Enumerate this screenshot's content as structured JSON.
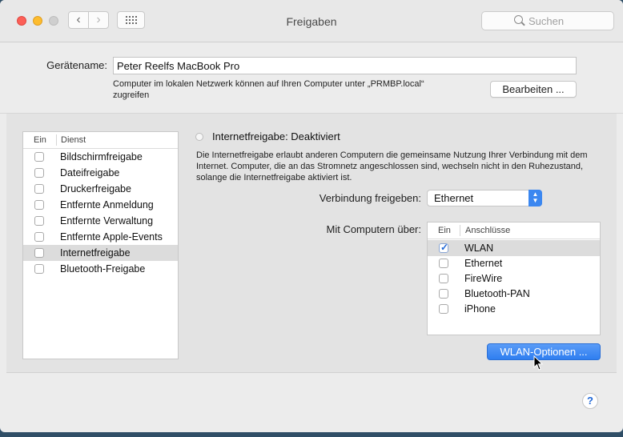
{
  "window": {
    "title": "Freigaben",
    "search_placeholder": "Suchen"
  },
  "device": {
    "label": "Gerätename:",
    "value": "Peter Reelfs MacBook Pro",
    "hint_line1": "Computer im lokalen Netzwerk können auf Ihren Computer unter „PRMBP.local“",
    "hint_line2": "zugreifen",
    "edit_button": "Bearbeiten ..."
  },
  "services": {
    "col_on": "Ein",
    "col_service": "Dienst",
    "items": [
      {
        "label": "Bildschirmfreigabe",
        "checked": false,
        "selected": false
      },
      {
        "label": "Dateifreigabe",
        "checked": false,
        "selected": false
      },
      {
        "label": "Druckerfreigabe",
        "checked": false,
        "selected": false
      },
      {
        "label": "Entfernte Anmeldung",
        "checked": false,
        "selected": false
      },
      {
        "label": "Entfernte Verwaltung",
        "checked": false,
        "selected": false
      },
      {
        "label": "Entfernte Apple-Events",
        "checked": false,
        "selected": false
      },
      {
        "label": "Internetfreigabe",
        "checked": false,
        "selected": true
      },
      {
        "label": "Bluetooth-Freigabe",
        "checked": false,
        "selected": false
      }
    ]
  },
  "detail": {
    "status": "Internetfreigabe: Deaktiviert",
    "description": "Die Internetfreigabe erlaubt anderen Computern die gemeinsame Nutzung Ihrer Verbindung mit dem Internet. Computer, die an das Stromnetz angeschlossen sind, wechseln nicht in den Ruhezustand, solange die Internetfreigabe aktiviert ist.",
    "share_label": "Verbindung freigeben:",
    "share_value": "Ethernet",
    "to_label": "Mit Computern über:",
    "ports_col_on": "Ein",
    "ports_col_name": "Anschlüsse",
    "ports": [
      {
        "label": "WLAN",
        "checked": true,
        "selected": true
      },
      {
        "label": "Ethernet",
        "checked": false,
        "selected": false
      },
      {
        "label": "FireWire",
        "checked": false,
        "selected": false
      },
      {
        "label": "Bluetooth-PAN",
        "checked": false,
        "selected": false
      },
      {
        "label": "iPhone",
        "checked": false,
        "selected": false
      }
    ],
    "wlan_button": "WLAN-Optionen ...",
    "help": "?"
  }
}
